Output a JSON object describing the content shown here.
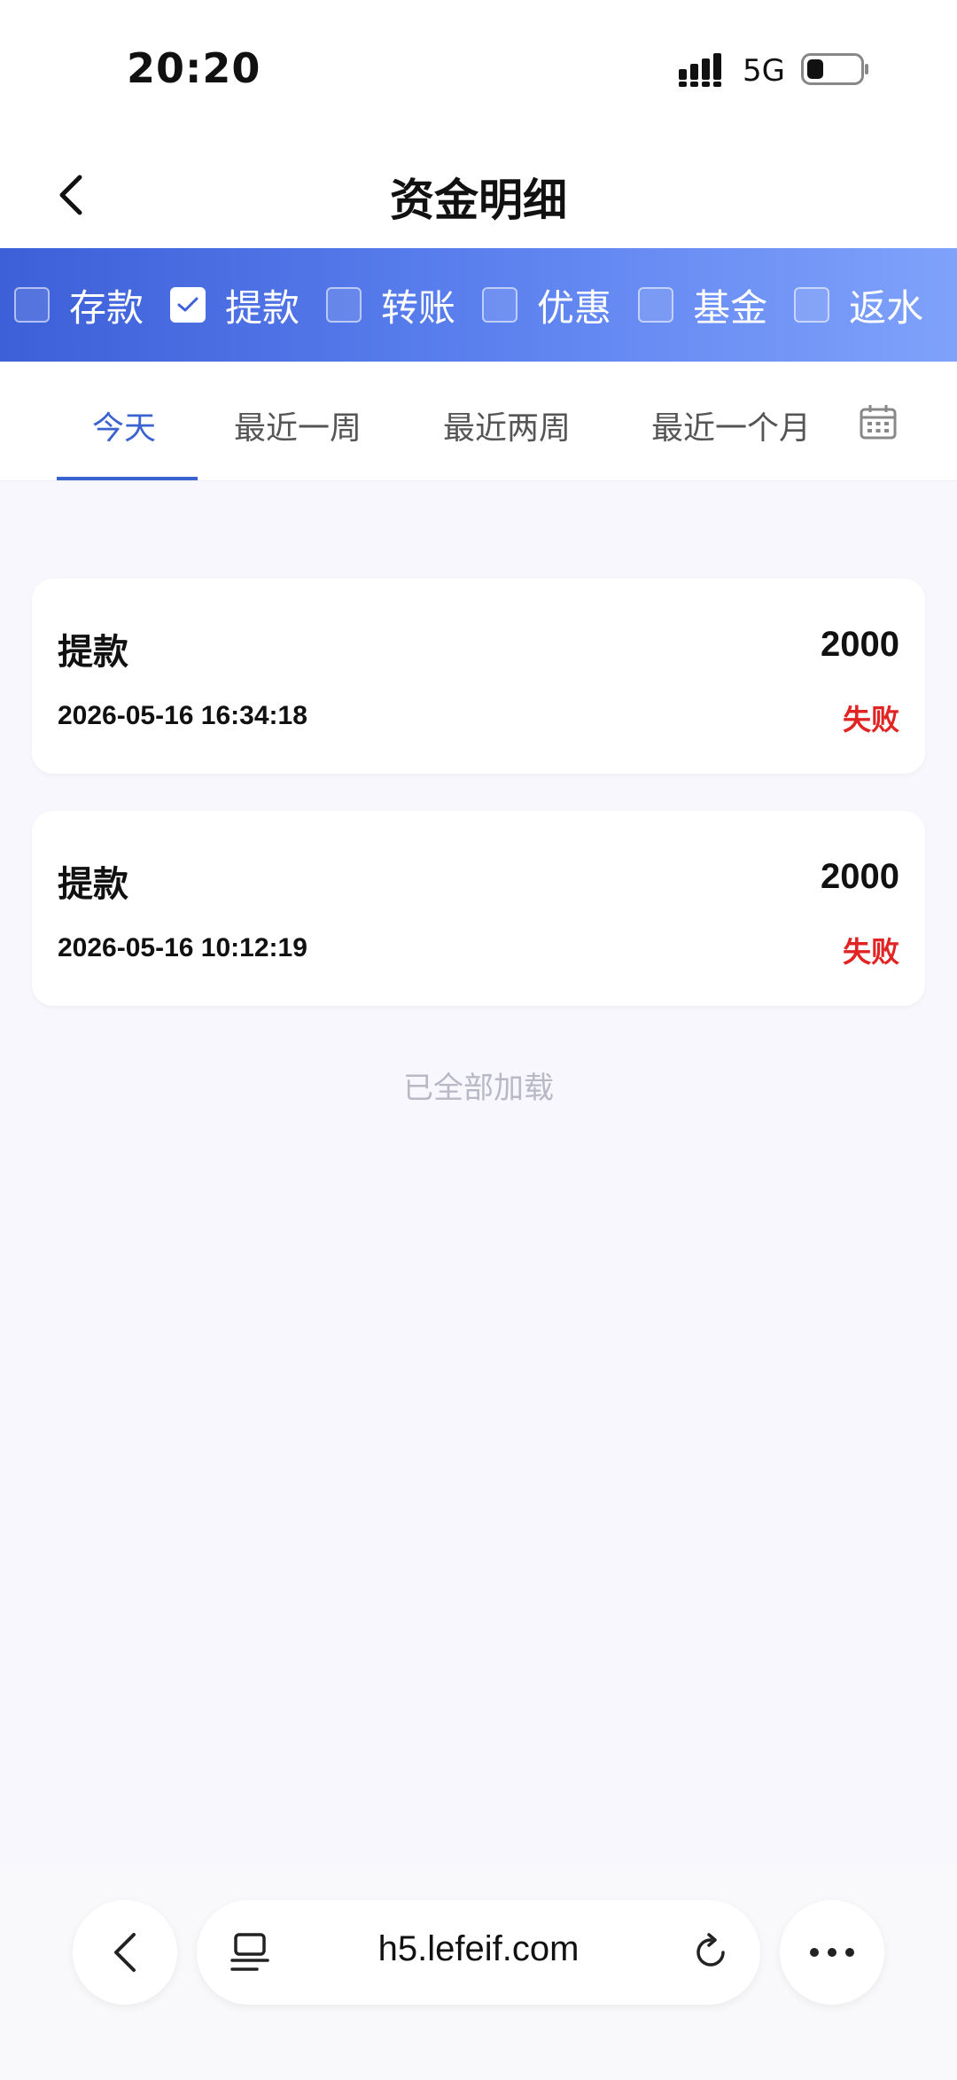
{
  "status_bar": {
    "time": "20:20",
    "network": "5G",
    "icons": [
      "signal-icon",
      "battery-icon"
    ]
  },
  "header": {
    "title": "资金明细",
    "back_icon": "chevron-left-icon"
  },
  "filters": {
    "items": [
      {
        "label": "存款",
        "checked": false
      },
      {
        "label": "提款",
        "checked": true
      },
      {
        "label": "转账",
        "checked": false
      },
      {
        "label": "优惠",
        "checked": false
      },
      {
        "label": "基金",
        "checked": false
      },
      {
        "label": "返水",
        "checked": false
      }
    ],
    "colors": {
      "gradient_start": "#3d5fd8",
      "gradient_end": "#7fa2fb"
    }
  },
  "range_tabs": {
    "items": [
      {
        "label": "今天",
        "active": true
      },
      {
        "label": "最近一周",
        "active": false
      },
      {
        "label": "最近两周",
        "active": false
      },
      {
        "label": "最近一个月",
        "active": false
      }
    ],
    "calendar_icon": "calendar-icon",
    "active_color": "#3b63cf"
  },
  "records": [
    {
      "type": "提款",
      "amount": "2000",
      "time": "2026-05-16 16:34:18",
      "status": "失败"
    },
    {
      "type": "提款",
      "amount": "2000",
      "time": "2026-05-16 10:12:19",
      "status": "失败"
    }
  ],
  "status_color": "#e02424",
  "list_footer": "已全部加载",
  "browser": {
    "url": "h5.lefeif.com",
    "icons": [
      "back-icon",
      "tabs-icon",
      "reload-icon",
      "more-icon"
    ]
  }
}
